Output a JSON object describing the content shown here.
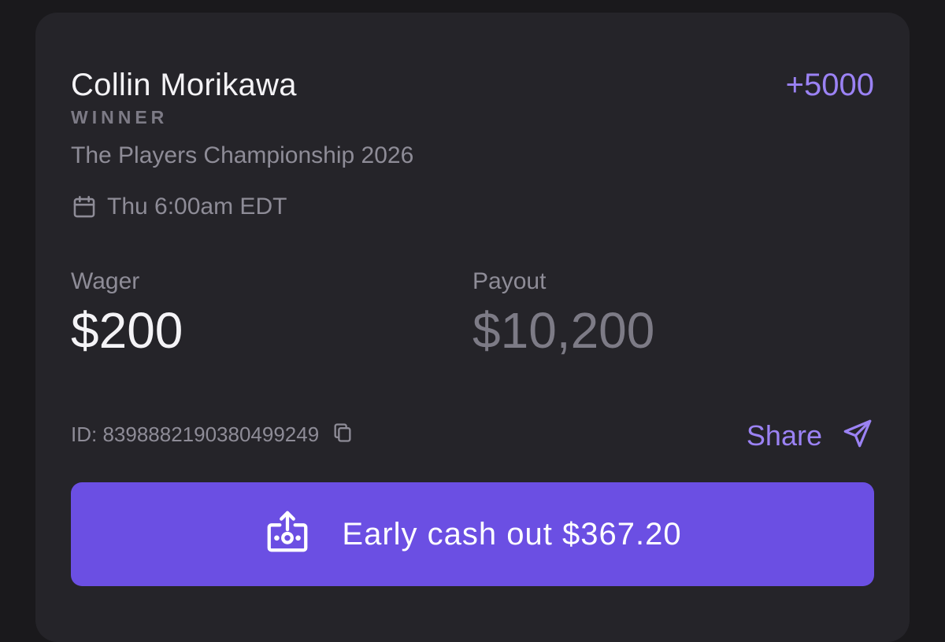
{
  "bet": {
    "selection": "Collin Morikawa",
    "odds": "+5000",
    "market": "WINNER",
    "event": "The Players Championship 2026",
    "start_time": "Thu 6:00am EDT",
    "wager_label": "Wager",
    "wager_value": "$200",
    "payout_label": "Payout",
    "payout_value": "$10,200",
    "id_text": "ID: 8398882190380499249",
    "share_label": "Share",
    "cashout_label": "Early cash out $367.20"
  },
  "icons": {
    "calendar": "calendar-icon",
    "copy": "copy-icon",
    "share": "send-icon",
    "cashout": "cash-out-icon"
  },
  "colors": {
    "background": "#1a191c",
    "card": "#252429",
    "accent": "#9b82f4",
    "button": "#6b4fe3",
    "primary_text": "#f4f3f6",
    "secondary_text": "#8e8c97"
  }
}
